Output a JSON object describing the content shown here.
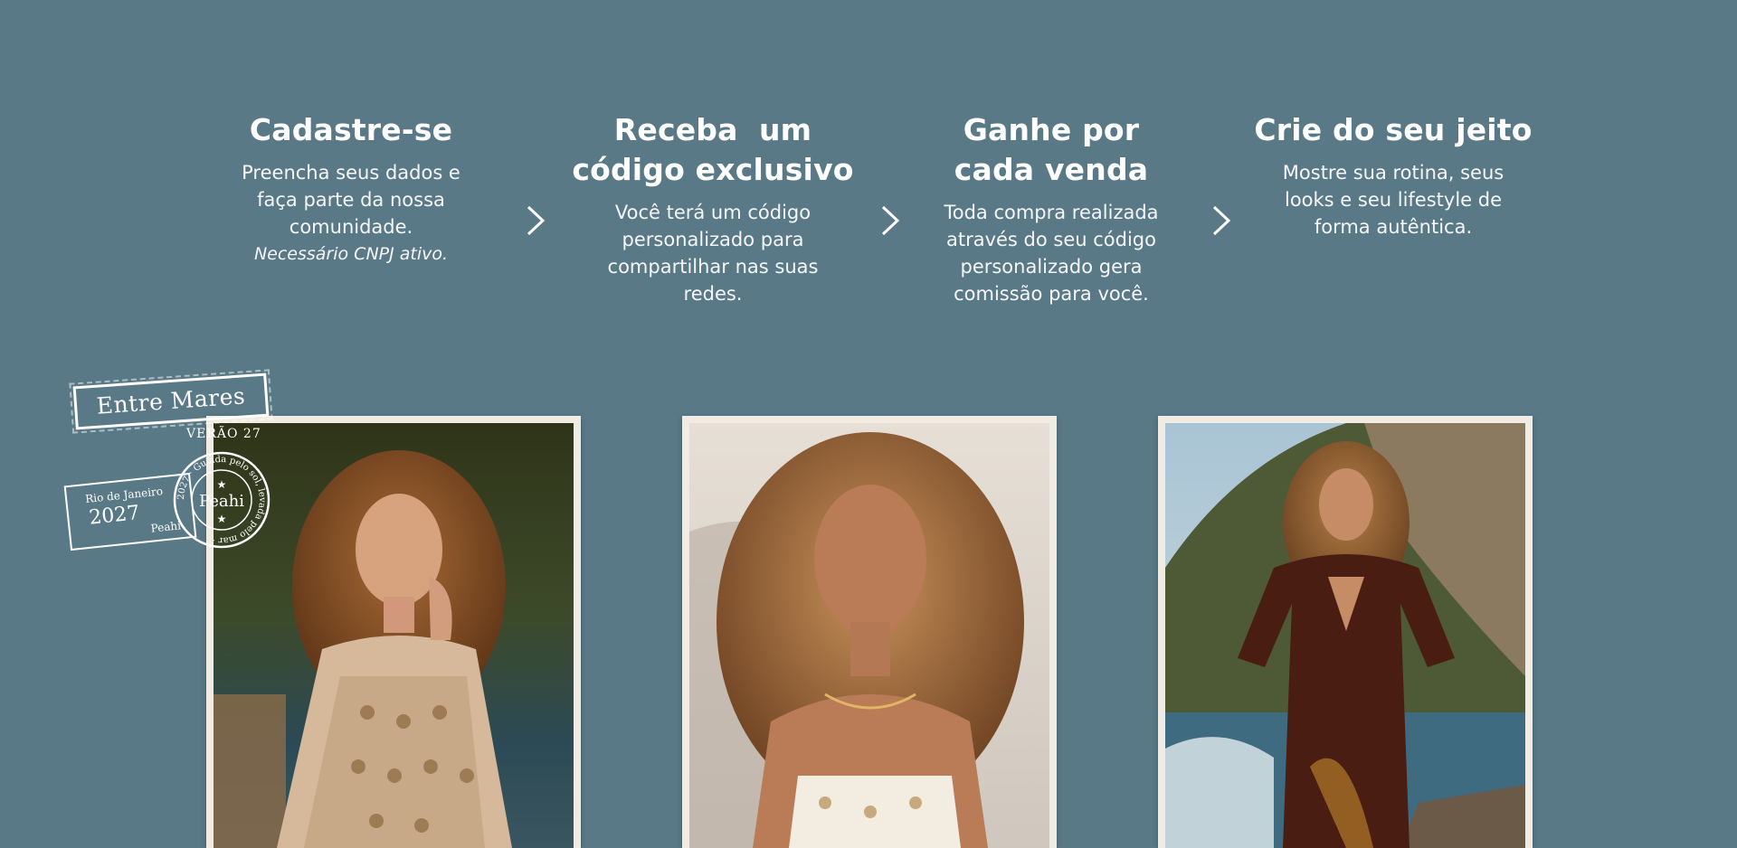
{
  "steps": [
    {
      "title": "Cadastre-se",
      "lines": [
        "Preencha seus dados e",
        "faça parte da nossa",
        "comunidade."
      ],
      "note": "Necessário CNPJ ativo."
    },
    {
      "title_line1": "Receba  um",
      "title_line2": "código exclusivo",
      "lines": [
        "Você terá um código",
        "personalizado para",
        "compartilhar nas suas",
        "redes."
      ]
    },
    {
      "title_line1": "Ganhe por",
      "title_line2": "cada venda",
      "lines": [
        "Toda compra realizada",
        "através do seu código",
        "personalizado gera",
        "comissão para você."
      ]
    },
    {
      "title": "Crie do seu jeito",
      "lines": [
        "Mostre sua rotina, seus",
        "looks e seu lifestyle de",
        "forma autêntica."
      ]
    }
  ],
  "stamps": {
    "collection": "Entre Mares",
    "season": "VERÃO 27",
    "postal_city": "Rio de Janeiro",
    "postal_year": "2027",
    "postal_brand": "Peahi",
    "circle_brand": "Peahi",
    "circle_text": "2027 · Guiada pelo sol, levada pelo mar ·"
  },
  "icons": {
    "chevron": "chevron-right-icon"
  },
  "colors": {
    "background": "#5a7987",
    "text": "#ffffff",
    "frame": "#f1ece3"
  }
}
